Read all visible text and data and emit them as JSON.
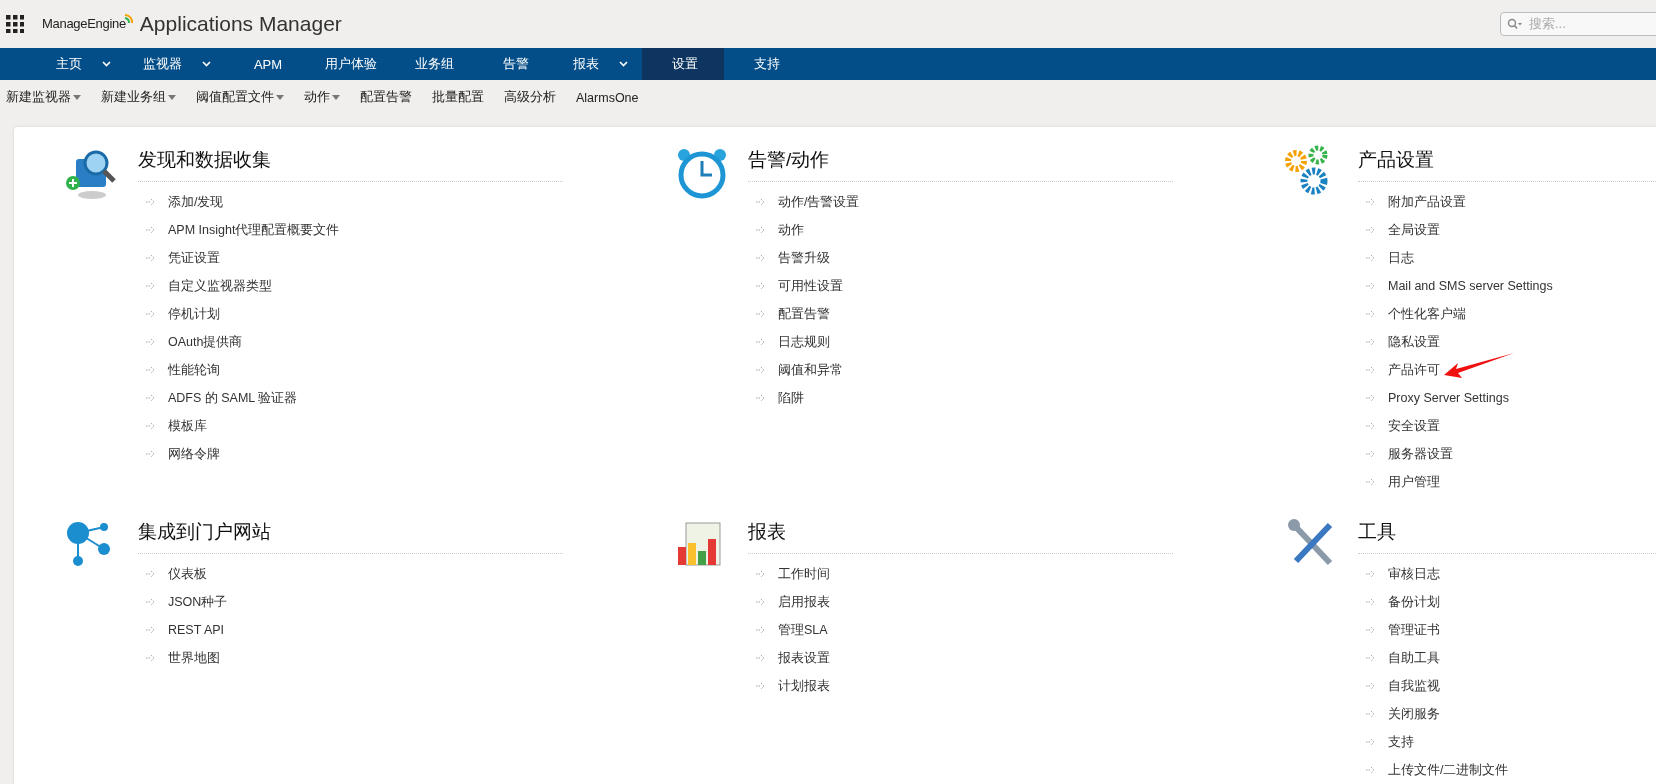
{
  "header": {
    "product_brand": "ManageEngine",
    "product_name": "Applications Manager",
    "search": {
      "placeholder": "搜索..."
    }
  },
  "nav": [
    {
      "label": "主页",
      "has_menu": true,
      "selected": false
    },
    {
      "label": "监视器",
      "has_menu": true,
      "selected": false
    },
    {
      "label": "APM",
      "has_menu": false,
      "selected": false
    },
    {
      "label": "用户体验",
      "has_menu": false,
      "selected": false
    },
    {
      "label": "业务组",
      "has_menu": false,
      "selected": false
    },
    {
      "label": "告警",
      "has_menu": false,
      "selected": false
    },
    {
      "label": "报表",
      "has_menu": true,
      "selected": false
    },
    {
      "label": "设置",
      "has_menu": false,
      "selected": true
    },
    {
      "label": "支持",
      "has_menu": false,
      "selected": false
    }
  ],
  "subnav": [
    {
      "label": "新建监视器",
      "has_menu": true
    },
    {
      "label": "新建业务组",
      "has_menu": true
    },
    {
      "label": "阈值配置文件",
      "has_menu": true
    },
    {
      "label": "动作",
      "has_menu": true
    },
    {
      "label": "配置告警",
      "has_menu": false
    },
    {
      "label": "批量配置",
      "has_menu": false
    },
    {
      "label": "高级分析",
      "has_menu": false
    },
    {
      "label": "AlarmsOne",
      "has_menu": false
    }
  ],
  "sections": [
    {
      "kind": "discovery",
      "title": "发现和数据收集",
      "items": [
        "添加/发现",
        "APM Insight代理配置概要文件",
        "凭证设置",
        "自定义监视器类型",
        "停机计划",
        "OAuth提供商",
        "性能轮询",
        "ADFS 的 SAML 验证器",
        "模板库",
        "网络令牌"
      ]
    },
    {
      "kind": "alarm",
      "title": "告警/动作",
      "items": [
        "动作/告警设置",
        "动作",
        "告警升级",
        "可用性设置",
        "配置告警",
        "日志规则",
        "阈值和异常",
        "陷阱"
      ]
    },
    {
      "kind": "gears",
      "title": "产品设置",
      "items": [
        "附加产品设置",
        "全局设置",
        "日志",
        "Mail and SMS server Settings",
        "个性化客户端",
        "隐私设置",
        "产品许可",
        "Proxy Server Settings",
        "安全设置",
        "服务器设置",
        "用户管理"
      ]
    },
    {
      "kind": "integration",
      "title": "集成到门户网站",
      "items": [
        "仪表板",
        "JSON种子",
        "REST API",
        "世界地图"
      ]
    },
    {
      "kind": "reports",
      "title": "报表",
      "items": [
        "工作时间",
        "启用报表",
        "管理SLA",
        "报表设置",
        "计划报表"
      ]
    },
    {
      "kind": "tools",
      "title": "工具",
      "items": [
        "审核日志",
        "备份计划",
        "管理证书",
        "自助工具",
        "自我监视",
        "关闭服务",
        "支持",
        "上传文件/二进制文件"
      ]
    }
  ]
}
